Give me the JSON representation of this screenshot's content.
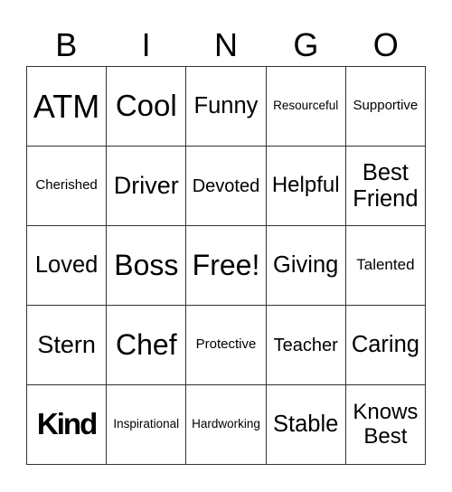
{
  "header": [
    "B",
    "I",
    "N",
    "G",
    "O"
  ],
  "rows": [
    [
      "ATM",
      "Cool",
      "Funny",
      "Resourceful",
      "Supportive"
    ],
    [
      "Cherished",
      "Driver",
      "Devoted",
      "Helpful",
      "Best Friend"
    ],
    [
      "Loved",
      "Boss",
      "Free!",
      "Giving",
      "Talented"
    ],
    [
      "Stern",
      "Chef",
      "Protective",
      "Teacher",
      "Caring"
    ],
    [
      "Kind",
      "Inspirational",
      "Hardworking",
      "Stable",
      "Knows Best"
    ]
  ]
}
